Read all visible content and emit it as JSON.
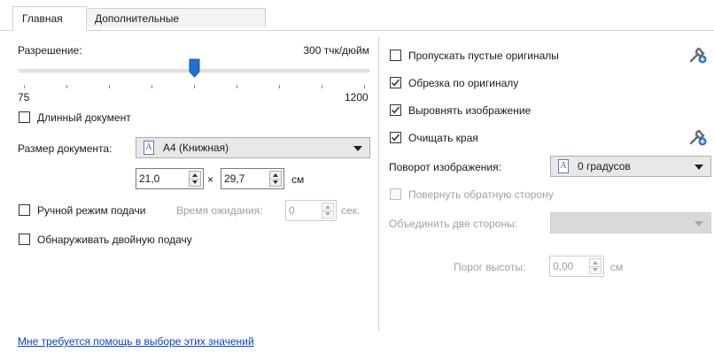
{
  "tabs": [
    {
      "label": "Главная",
      "active": true
    },
    {
      "label": "Дополнительные",
      "active": false
    }
  ],
  "left": {
    "resolution": {
      "label": "Разрешение:",
      "value_text": "300 тчк/дюйм",
      "min_label": "75",
      "max_label": "1200",
      "level": 0.5
    },
    "long_document": {
      "label": "Длинный документ",
      "checked": false
    },
    "document_size": {
      "label": "Размер документа:",
      "selected": "A4 (Книжная)",
      "width": "21,0",
      "times": "×",
      "height": "29,7",
      "unit": "см"
    },
    "manual_feed": {
      "label": "Ручной режим подачи",
      "checked": false
    },
    "wait_time": {
      "label": "Время ожидания:",
      "value": "0",
      "unit": "сек."
    },
    "double_feed": {
      "label": "Обнаруживать двойную подачу",
      "checked": false
    }
  },
  "right": {
    "skip_blank": {
      "label": "Пропускать пустые оригиналы",
      "checked": false
    },
    "crop": {
      "label": "Обрезка по оригиналу",
      "checked": true
    },
    "straighten": {
      "label": "Выровнять изображение",
      "checked": true
    },
    "edge_clean": {
      "label": "Очищать края",
      "checked": true
    },
    "rotation": {
      "label": "Поворот изображения:",
      "selected": "0 градусов"
    },
    "rotate_back": {
      "label": "Повернуть обратную сторону",
      "checked": false
    },
    "merge": {
      "label": "Объединить две стороны:",
      "selected": ""
    },
    "height_threshold": {
      "label": "Порог высоты:",
      "value": "0,00",
      "unit": "см"
    }
  },
  "help_link": "Мне требуется помощь в выборе этих значений",
  "colors": {
    "accent": "#1f6fd1",
    "link": "#0645d6"
  }
}
